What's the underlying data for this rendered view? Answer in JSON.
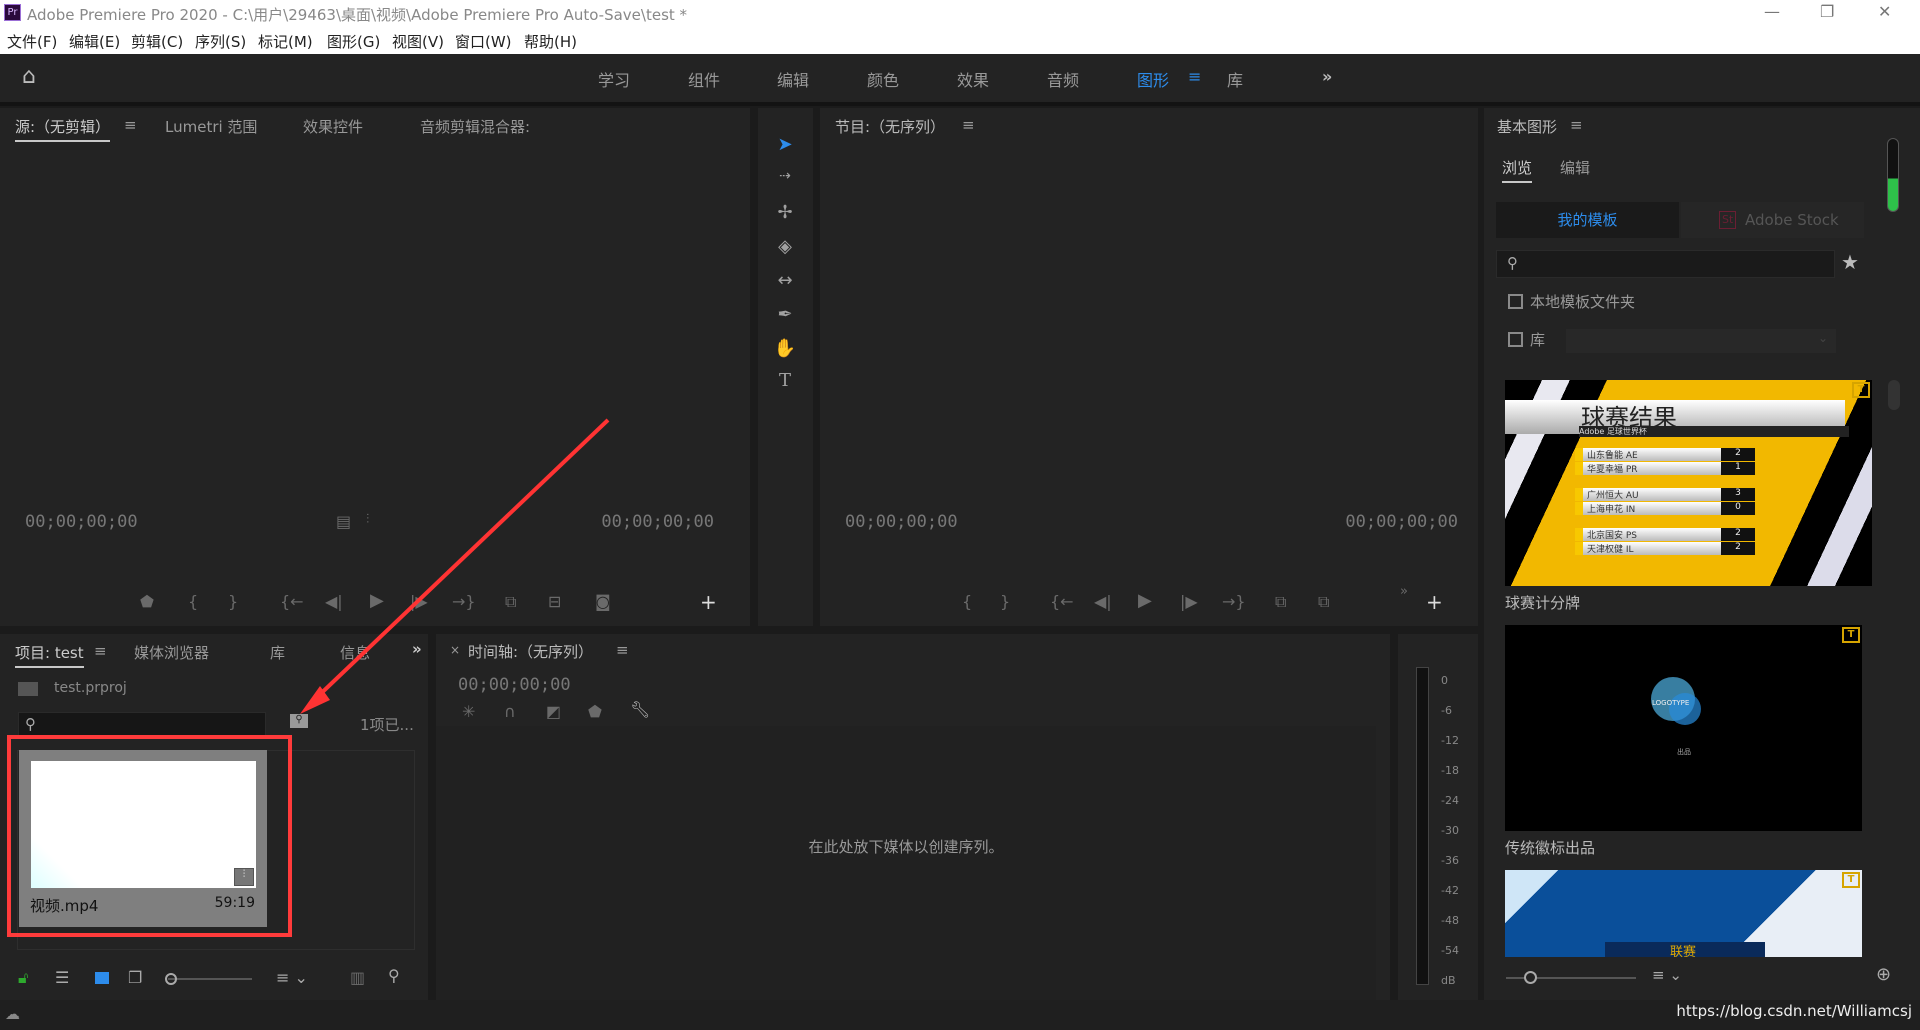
{
  "window": {
    "title": "Adobe Premiere Pro 2020 - C:\\用户\\29463\\桌面\\视频\\Adobe Premiere Pro Auto-Save\\test *",
    "app_icon": "Pr",
    "controls": [
      "minimize-icon",
      "restore-icon",
      "close-icon"
    ]
  },
  "menu": [
    "文件(F)",
    "编辑(E)",
    "剪辑(C)",
    "序列(S)",
    "标记(M)",
    "图形(G)",
    "视图(V)",
    "窗口(W)",
    "帮助(H)"
  ],
  "workspaces": {
    "items": [
      "学习",
      "组件",
      "编辑",
      "颜色",
      "效果",
      "音频",
      "图形",
      "库"
    ],
    "active": "图形",
    "more": "»",
    "accent": "#2d8ceb"
  },
  "source": {
    "tabs": [
      "源:（无剪辑）",
      "Lumetri 范围",
      "效果控件",
      "音频剪辑混合器:"
    ],
    "timecode_in": "00;00;00;00",
    "timecode_out": "00;00;00;00"
  },
  "program": {
    "tab": "节目:（无序列）",
    "timecode_in": "00;00;00;00",
    "timecode_out": "00;00;00;00"
  },
  "tools": [
    "selection-tool",
    "track-select-tool",
    "ripple-edit-tool",
    "razor-tool",
    "slip-tool",
    "pen-tool",
    "hand-tool",
    "type-tool"
  ],
  "project": {
    "tabs": [
      "项目: test",
      "媒体浏览器",
      "库",
      "信息"
    ],
    "more": "»",
    "file": "test.prproj",
    "count": "1项已...",
    "item": {
      "name": "视频.mp4",
      "duration": "59:19"
    }
  },
  "timeline": {
    "tab": "时间轴:（无序列）",
    "timecode": "00;00;00;00",
    "drop_hint": "在此处放下媒体以创建序列。"
  },
  "meter": {
    "labels": [
      "0",
      "-6",
      "-12",
      "-18",
      "-24",
      "-30",
      "-36",
      "-42",
      "-48",
      "-54",
      "dB"
    ]
  },
  "graphics": {
    "title": "基本图形",
    "tabs": [
      "浏览",
      "编辑"
    ],
    "sources": [
      "我的模板",
      "Adobe Stock"
    ],
    "stock_badge": "St",
    "local_folder": "本地模板文件夹",
    "library": "库",
    "templates": [
      {
        "name": "球赛计分牌",
        "preview_title": "球赛结果",
        "preview_subtitle": "Adobe 足球世界杯",
        "rows": [
          [
            "山东鲁能 AE",
            "2"
          ],
          [
            "华夏幸福 PR",
            "1"
          ],
          [
            "广州恒大 AU",
            "3"
          ],
          [
            "上海申花 IN",
            "0"
          ],
          [
            "北京国安 PS",
            "2"
          ],
          [
            "天津权健 IL",
            "2"
          ]
        ]
      },
      {
        "name": "传统徽标出品",
        "preview_logo": "LOGOTYPE",
        "preview_caption": "出品"
      },
      {
        "name": "",
        "preview_text": "联赛"
      }
    ]
  },
  "watermark": "https://blog.csdn.net/Williamcsj"
}
